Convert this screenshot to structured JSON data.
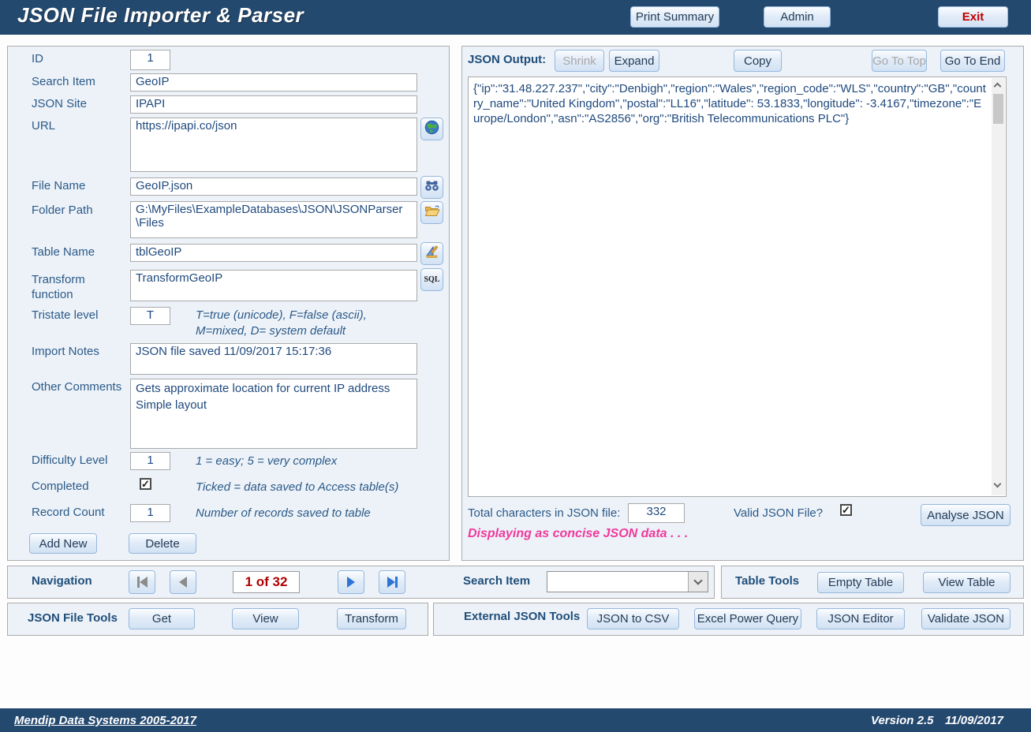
{
  "header": {
    "title": "JSON File Importer & Parser",
    "print_summary": "Print Summary",
    "admin": "Admin",
    "exit": "Exit"
  },
  "form": {
    "id_label": "ID",
    "id_value": "1",
    "search_item_label": "Search Item",
    "search_item_value": "GeoIP",
    "json_site_label": "JSON Site",
    "json_site_value": "IPAPI",
    "url_label": "URL",
    "url_value": "https://ipapi.co/json",
    "file_name_label": "File Name",
    "file_name_value": "GeoIP.json",
    "folder_path_label": "Folder Path",
    "folder_path_value": "G:\\MyFiles\\ExampleDatabases\\JSON\\JSONParser\\Files",
    "table_name_label": "Table Name",
    "table_name_value": "tblGeoIP",
    "transform_label": "Transform function",
    "transform_value": "TransformGeoIP",
    "tristate_label": "Tristate level",
    "tristate_value": "T",
    "tristate_hint1": "T=true (unicode), F=false (ascii),",
    "tristate_hint2": "M=mixed, D= system default",
    "import_notes_label": "Import Notes",
    "import_notes_value": "JSON file saved 11/09/2017 15:17:36",
    "other_comments_label": "Other Comments",
    "other_comments_value": "Gets approximate location for current IP address\nSimple layout",
    "difficulty_label": "Difficulty Level",
    "difficulty_value": "1",
    "difficulty_hint": "1 = easy; 5 = very complex",
    "completed_label": "Completed",
    "completed_check": "✓",
    "completed_hint": "Ticked = data saved to Access table(s)",
    "record_count_label": "Record Count",
    "record_count_value": "1",
    "record_count_hint": "Number of records saved to table",
    "add_new": "Add New",
    "delete": "Delete",
    "sql_icon_text": "SQL"
  },
  "output": {
    "label": "JSON Output:",
    "shrink": "Shrink",
    "expand": "Expand",
    "copy": "Copy",
    "go_top": "Go To Top",
    "go_end": "Go To End",
    "json_text": "{\"ip\":\"31.48.227.237\",\"city\":\"Denbigh\",\"region\":\"Wales\",\"region_code\":\"WLS\",\"country\":\"GB\",\"country_name\":\"United Kingdom\",\"postal\":\"LL16\",\"latitude\": 53.1833,\"longitude\": -3.4167,\"timezone\":\"Europe/London\",\"asn\":\"AS2856\",\"org\":\"British Telecommunications PLC\"}",
    "total_label": "Total characters in JSON file:",
    "total_value": "332",
    "valid_label": "Valid JSON File?",
    "valid_check": "✓",
    "analyse": "Analyse JSON",
    "status": "Displaying as concise JSON data . . ."
  },
  "nav": {
    "label": "Navigation",
    "position": "1 of 32",
    "search_label": "Search Item"
  },
  "table_tools": {
    "label": "Table Tools",
    "empty": "Empty Table",
    "view": "View Table"
  },
  "file_tools": {
    "label": "JSON File Tools",
    "get": "Get",
    "view": "View",
    "transform": "Transform"
  },
  "external_tools": {
    "label": "External JSON Tools",
    "json_to_csv": "JSON to CSV",
    "excel_pq": "Excel Power Query",
    "json_editor": "JSON Editor",
    "validate": "Validate JSON"
  },
  "footer": {
    "company": "Mendip Data Systems 2005-2017",
    "version": "Version 2.5",
    "date": "11/09/2017"
  },
  "colors": {
    "header_bg": "#24496F",
    "panel_bg": "#EDF2F9",
    "accent_text": "#1F4E79",
    "exit_red": "#C00000",
    "status_pink": "#F0399B",
    "record_red": "#B00000",
    "json_text": "#1F497D"
  }
}
